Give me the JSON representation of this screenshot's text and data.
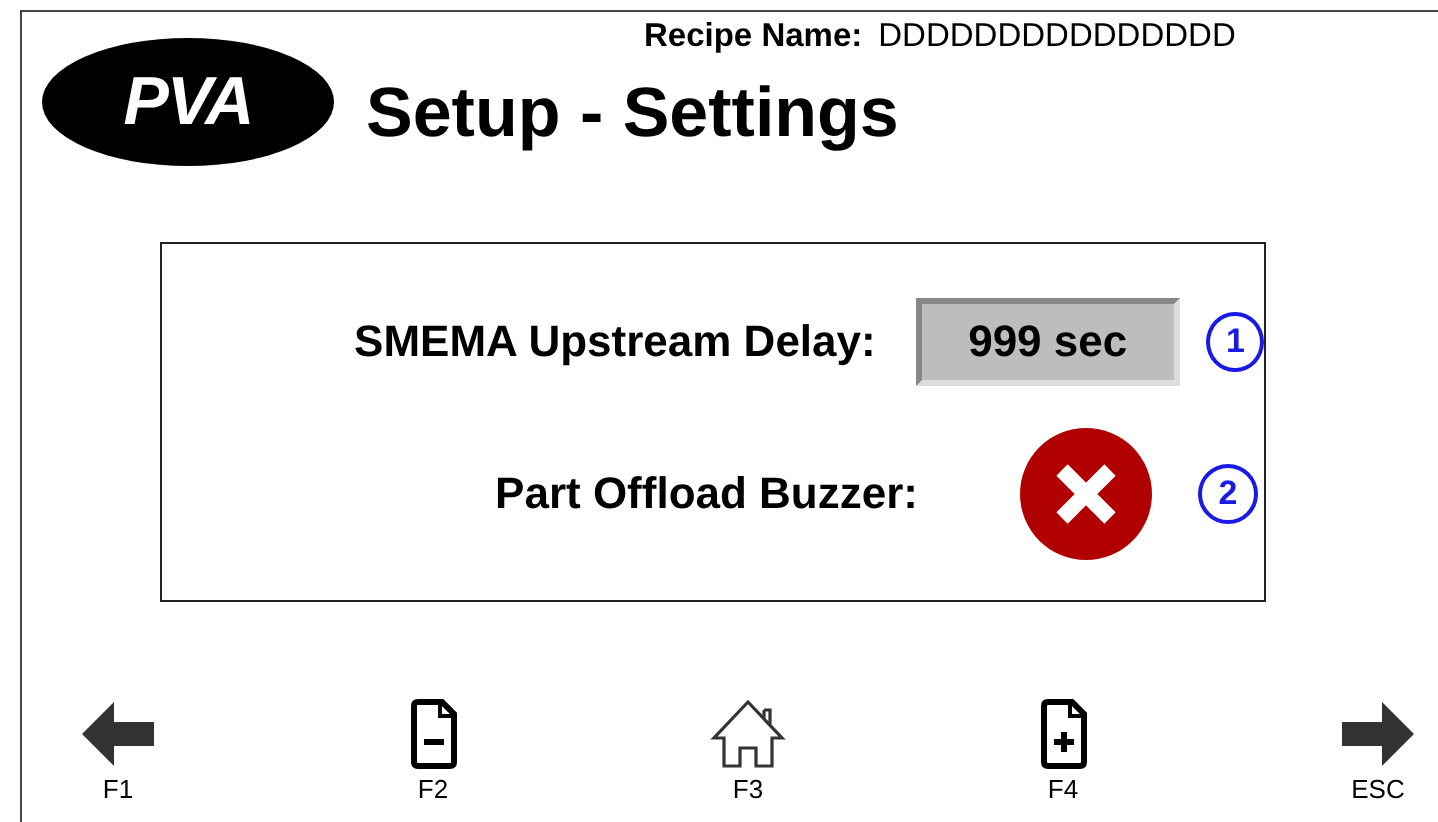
{
  "header": {
    "logo": "PVA",
    "title": "Setup - Settings",
    "recipe_label": "Recipe Name:",
    "recipe_value": "DDDDDDDDDDDDDDD"
  },
  "settings": [
    {
      "kind": "value",
      "label": "SMEMA Upstream Delay:",
      "value": "999 sec",
      "marker": "1"
    },
    {
      "kind": "toggle",
      "label": "Part Offload Buzzer:",
      "on": false,
      "marker": "2"
    }
  ],
  "function_keys": [
    {
      "kind": "arrow-left",
      "label": "F1"
    },
    {
      "kind": "doc-minus",
      "label": "F2"
    },
    {
      "kind": "home",
      "label": "F3"
    },
    {
      "kind": "doc-plus",
      "label": "F4"
    },
    {
      "kind": "arrow-right",
      "label": "ESC"
    }
  ]
}
